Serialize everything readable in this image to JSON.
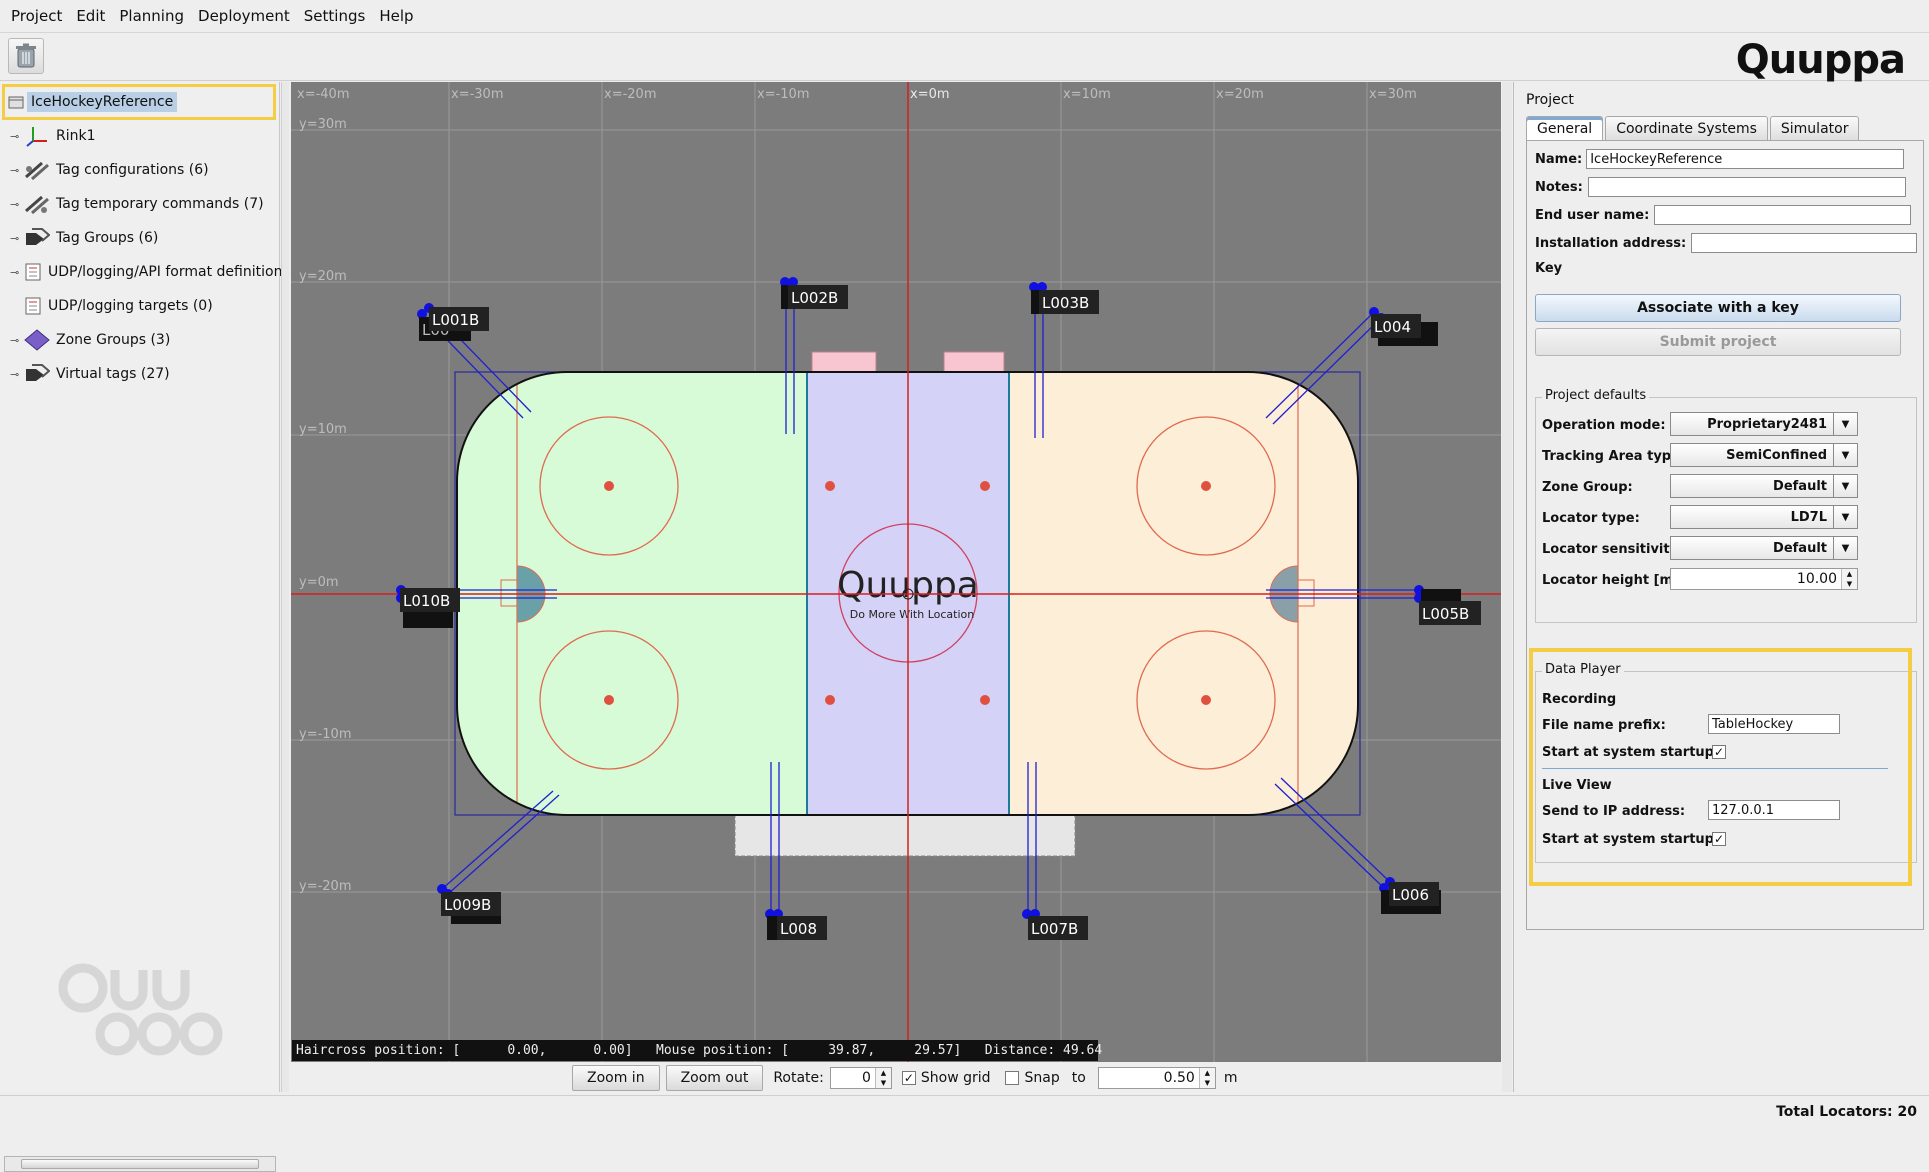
{
  "menu": [
    "Project",
    "Edit",
    "Planning",
    "Deployment",
    "Settings",
    "Help"
  ],
  "brand": "Quuppa",
  "tree": {
    "root": "IceHockeyReference",
    "items": [
      {
        "label": "Rink1",
        "icon": "axes-icon"
      },
      {
        "label": "Tag configurations (6)",
        "icon": "tag-config-icon"
      },
      {
        "label": "Tag temporary commands (7)",
        "icon": "tag-command-icon"
      },
      {
        "label": "Tag Groups (6)",
        "icon": "tag-group-icon"
      },
      {
        "label": "UDP/logging/API format definitions (",
        "icon": "format-icon"
      },
      {
        "label": "UDP/logging targets (0)",
        "icon": "target-icon"
      },
      {
        "label": "Zone Groups (3)",
        "icon": "zone-group-icon"
      },
      {
        "label": "Virtual tags (27)",
        "icon": "virtual-tag-icon"
      }
    ]
  },
  "canvas": {
    "x_ticks": [
      "x=-40m",
      "x=-30m",
      "x=-20m",
      "x=-10m",
      "x=0m",
      "x=10m",
      "x=20m",
      "x=30m"
    ],
    "y_ticks": [
      "y=30m",
      "y=20m",
      "y=10m",
      "y=0m",
      "y=-10m",
      "y=-20m"
    ],
    "center_logo": "Quuppa",
    "center_tagline": "Do More With Location",
    "locators": [
      "L001B",
      "L002B",
      "L003B",
      "L004",
      "L005B",
      "L006",
      "L007B",
      "L008",
      "L009B",
      "L010B"
    ]
  },
  "status": {
    "haircross": "Haircross position: [      0.00,      0.00]   Mouse position: [     39.87,     29.57]   Distance: 49.64"
  },
  "bottom": {
    "zoom_in": "Zoom in",
    "zoom_out": "Zoom out",
    "rotate_label": "Rotate:",
    "rotate_value": "0",
    "show_grid": "Show grid",
    "snap": "Snap",
    "to": "to",
    "snap_value": "0.50",
    "unit": "m"
  },
  "right": {
    "title": "Project",
    "tabs": [
      "General",
      "Coordinate Systems",
      "Simulator"
    ],
    "name_label": "Name:",
    "name_value": "IceHockeyReference",
    "notes_label": "Notes:",
    "end_user_label": "End user name:",
    "install_label": "Installation address:",
    "key_label": "Key",
    "associate_btn": "Associate with a key",
    "submit_btn": "Submit project",
    "defaults_title": "Project defaults",
    "defaults": [
      {
        "label": "Operation mode:",
        "value": "Proprietary2481"
      },
      {
        "label": "Tracking Area type:",
        "value": "SemiConfined"
      },
      {
        "label": "Zone Group:",
        "value": "Default"
      },
      {
        "label": "Locator type:",
        "value": "LD7L"
      },
      {
        "label": "Locator sensitivity:",
        "value": "Default"
      }
    ],
    "height_label": "Locator height  [m]:",
    "height_value": "10.00",
    "player_title": "Data Player",
    "recording": "Recording",
    "prefix_label": "File name prefix:",
    "prefix_value": "TableHockey",
    "startup_label": "Start at system startup:",
    "liveview": "Live View",
    "ip_label": "Send to IP address:",
    "ip_value": "127.0.0.1",
    "startup_label2": "Start at system startup:"
  },
  "footer": "Total Locators: 20",
  "colors": {
    "selection": "#b8cfe5",
    "highlight": "#f5cd45",
    "accent": "#7fa8d4"
  }
}
